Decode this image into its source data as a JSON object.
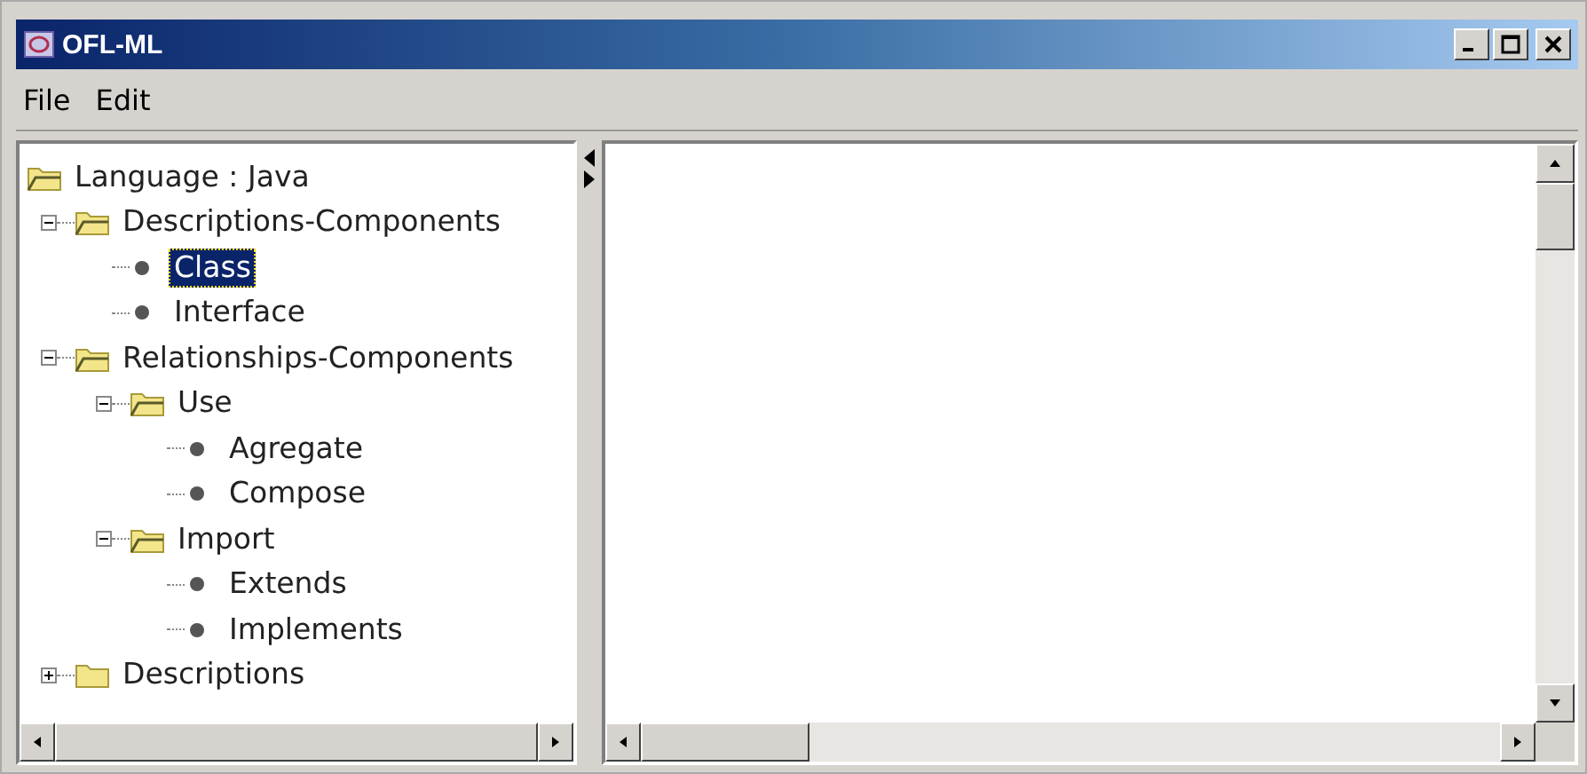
{
  "window": {
    "title": "OFL-ML"
  },
  "menu": [
    "File",
    "Edit"
  ],
  "tree": [
    {
      "label": "Language : Java",
      "kind": "folder",
      "expanded": true,
      "selected": false,
      "children": [
        {
          "label": "Descriptions-Components",
          "kind": "folder",
          "expanded": true,
          "selected": false,
          "children": [
            {
              "label": "Class",
              "kind": "leaf",
              "selected": true
            },
            {
              "label": "Interface",
              "kind": "leaf",
              "selected": false
            }
          ]
        },
        {
          "label": "Relationships-Components",
          "kind": "folder",
          "expanded": true,
          "selected": false,
          "children": [
            {
              "label": "Use",
              "kind": "folder",
              "expanded": true,
              "selected": false,
              "children": [
                {
                  "label": "Agregate",
                  "kind": "leaf",
                  "selected": false
                },
                {
                  "label": "Compose",
                  "kind": "leaf",
                  "selected": false
                }
              ]
            },
            {
              "label": "Import",
              "kind": "folder",
              "expanded": true,
              "selected": false,
              "children": [
                {
                  "label": "Extends",
                  "kind": "leaf",
                  "selected": false
                },
                {
                  "label": "Implements",
                  "kind": "leaf",
                  "selected": false
                }
              ]
            }
          ]
        },
        {
          "label": "Descriptions",
          "kind": "folder",
          "expanded": false,
          "selected": false
        }
      ]
    }
  ]
}
